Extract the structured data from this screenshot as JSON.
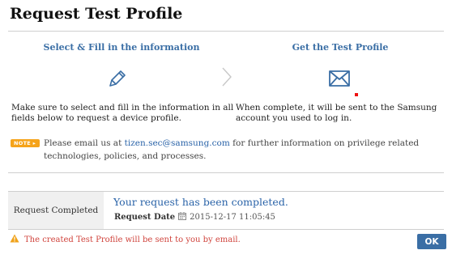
{
  "dialog": {
    "title": "Request Test Profile"
  },
  "steps": [
    {
      "title": "Select & Fill in the information",
      "icon": "pencil-icon",
      "description_line1": "Make sure to select and fill in the information in all",
      "description_line2": "fields below to request a device profile."
    },
    {
      "title": "Get the Test Profile",
      "icon": "envelope-icon",
      "description_line1": "When complete, it will be sent to the Samsung",
      "description_line2": "account you used to log in."
    }
  ],
  "note": {
    "badge": "NOTE ▸",
    "text_before": "Please email us at ",
    "email": "tizen.sec@samsung.com",
    "text_after": " for further information on privilege related technologies, policies, and processes."
  },
  "result": {
    "label": "Request Completed",
    "message": "Your request has been completed.",
    "date_label": "Request Date",
    "date_value": "2015-12-17 11:05:45"
  },
  "warning": {
    "text": "The created Test Profile will be sent to you by email."
  },
  "actions": {
    "ok_label": "OK"
  },
  "colors": {
    "accent": "#3a6ea5",
    "link": "#2a63a8",
    "warning": "#d0443d",
    "note_badge": "#f5a31a"
  }
}
